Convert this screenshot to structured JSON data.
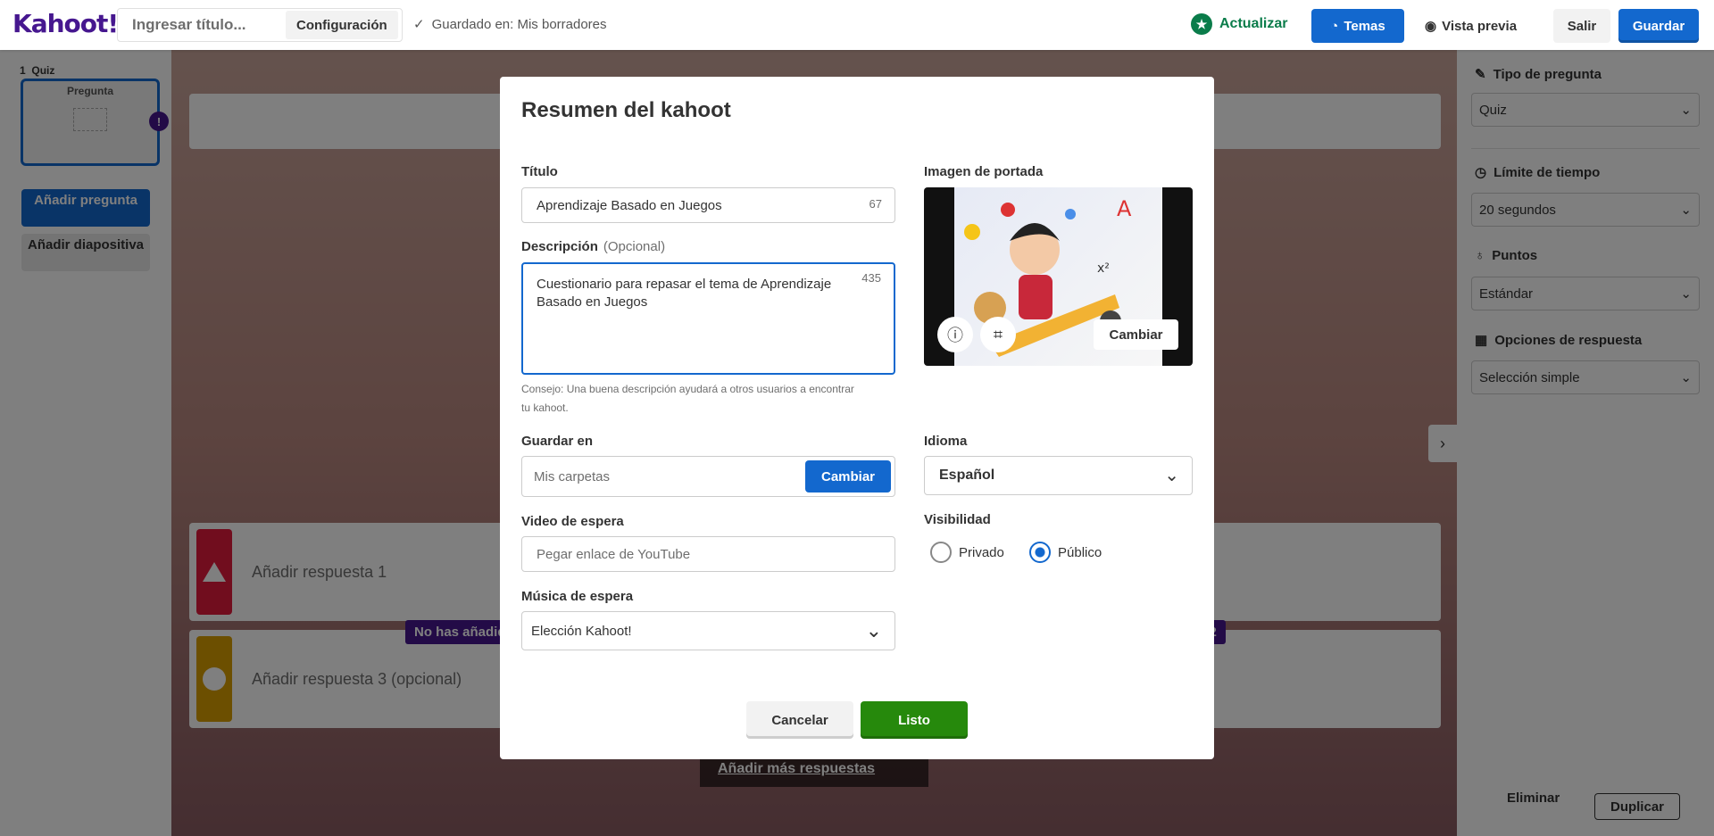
{
  "topbar": {
    "logo": "Kahoot!",
    "title_placeholder": "Ingresar título...",
    "settings_label": "Configuración",
    "saved_label": "Guardado en: Mis borradores",
    "upgrade_label": "Actualizar",
    "themes_label": "Temas",
    "preview_label": "Vista previa",
    "exit_label": "Salir",
    "save_label": "Guardar"
  },
  "sidebar": {
    "slide": {
      "number": "1",
      "type": "Quiz",
      "thumb_label": "Pregunta",
      "timer": "20"
    },
    "add_question": "Añadir pregunta",
    "add_slide": "Añadir diapositiva"
  },
  "canvas": {
    "answers": [
      {
        "label": "Añadir respuesta 1",
        "color": "#e21b3c",
        "shape": "triangle"
      },
      {
        "label": "Añadir respuesta 3 (opcional)",
        "color": "#d89e00",
        "shape": "circle"
      }
    ],
    "badge_left": "No has añadido",
    "badge_right": "a 2",
    "more_answers": "Añadir más respuestas"
  },
  "right_panel": {
    "question_type": {
      "label": "Tipo de pregunta",
      "value": "Quiz"
    },
    "time_limit": {
      "label": "Límite de tiempo",
      "value": "20 segundos"
    },
    "points": {
      "label": "Puntos",
      "value": "Estándar"
    },
    "answer_options": {
      "label": "Opciones de respuesta",
      "value": "Selección simple"
    },
    "delete_label": "Eliminar",
    "duplicate_label": "Duplicar"
  },
  "modal": {
    "title": "Resumen del kahoot",
    "title_field": {
      "label": "Título",
      "value": "Aprendizaje Basado en Juegos",
      "counter": "67"
    },
    "description": {
      "label": "Descripción",
      "optional": "(Opcional)",
      "value": "Cuestionario para repasar el tema de Aprendizaje Basado en Juegos",
      "counter": "435"
    },
    "hint": "Consejo: Una buena descripción ayudará a otros usuarios a encontrar tu kahoot.",
    "save_in": {
      "label": "Guardar en",
      "value": "Mis carpetas",
      "button": "Cambiar"
    },
    "lobby_video": {
      "label": "Video de espera",
      "placeholder": "Pegar enlace de YouTube"
    },
    "lobby_music": {
      "label": "Música de espera",
      "value": "Elección Kahoot!"
    },
    "cover": {
      "label": "Imagen de portada",
      "change": "Cambiar"
    },
    "language": {
      "label": "Idioma",
      "value": "Español"
    },
    "visibility": {
      "label": "Visibilidad",
      "private": "Privado",
      "public": "Público",
      "selected": "public"
    },
    "cancel": "Cancelar",
    "done": "Listo"
  },
  "colors": {
    "brand": "#46178f",
    "primary": "#1368ce",
    "success": "#26890c",
    "red": "#e21b3c",
    "yellow": "#d89e00"
  }
}
